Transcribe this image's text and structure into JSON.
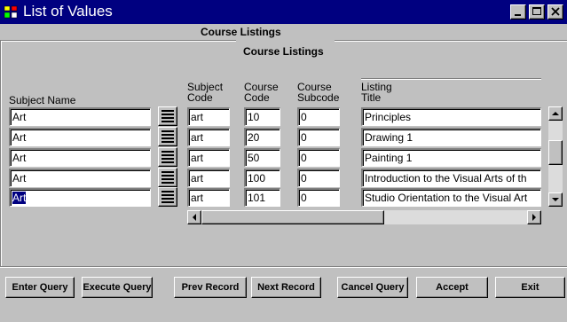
{
  "window": {
    "title": "List of Values"
  },
  "form": {
    "outer_heading": "Course Listings",
    "inner_heading": "Course Listings"
  },
  "columns": {
    "subject_name": "Subject Name",
    "subject_code": [
      "Subject",
      "Code"
    ],
    "course_code": [
      "Course",
      "Code"
    ],
    "course_subcode": [
      "Course",
      "Subcode"
    ],
    "listing_title": [
      "Listing",
      "Title"
    ]
  },
  "rows": [
    {
      "subject_name": "Art",
      "subject_code": "art",
      "course_code": "10",
      "course_subcode": "0",
      "listing_title": "Principles"
    },
    {
      "subject_name": "Art",
      "subject_code": "art",
      "course_code": "20",
      "course_subcode": "0",
      "listing_title": "Drawing 1"
    },
    {
      "subject_name": "Art",
      "subject_code": "art",
      "course_code": "50",
      "course_subcode": "0",
      "listing_title": "Painting 1"
    },
    {
      "subject_name": "Art",
      "subject_code": "art",
      "course_code": "100",
      "course_subcode": "0",
      "listing_title": "Introduction to the Visual Arts of th"
    },
    {
      "subject_name": "Art",
      "subject_code": "art",
      "course_code": "101",
      "course_subcode": "0",
      "listing_title": "Studio Orientation to the Visual Art"
    }
  ],
  "buttons": {
    "enter_query": "Enter Query",
    "execute_query": "Execute Query",
    "prev_record": "Prev Record",
    "next_record": "Next Record",
    "cancel_query": "Cancel Query",
    "accept": "Accept",
    "exit": "Exit"
  },
  "icons": {
    "title_icon": "app-icon",
    "minimize": "minimize-icon",
    "maximize": "maximize-icon",
    "close": "close-icon",
    "lov": "list-of-values-icon"
  },
  "colors": {
    "titlebar": "#000080",
    "window_bg": "#c0c0c0",
    "field_bg": "#ffffff",
    "selection": "#000080"
  }
}
